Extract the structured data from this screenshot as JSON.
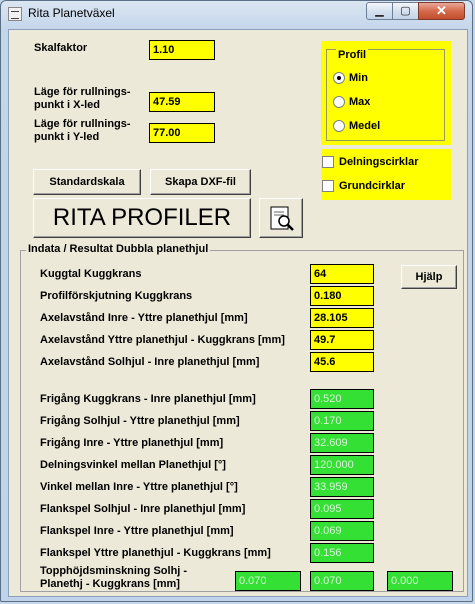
{
  "window": {
    "title": "Rita Planetväxel",
    "close_label": "✕",
    "min_label": "▁",
    "max_label": "▢"
  },
  "inputs": {
    "skalfaktor_label": "Skalfaktor",
    "skalfaktor_value": "1.10",
    "x_label_line1": "Läge för rullnings-",
    "x_label_line2": "punkt i X-led",
    "x_value": "47.59",
    "y_label_line1": "Läge för rullnings-",
    "y_label_line2": "punkt i Y-led",
    "y_value": "77.00"
  },
  "profil": {
    "title": "Profil",
    "options": [
      {
        "label": "Min",
        "selected": true
      },
      {
        "label": "Max",
        "selected": false
      },
      {
        "label": "Medel",
        "selected": false
      }
    ]
  },
  "checks": [
    {
      "label": "Delningscirklar",
      "checked": false
    },
    {
      "label": "Grundcirklar",
      "checked": false
    }
  ],
  "buttons": {
    "standardskala": "Standardskala",
    "dxf": "Skapa DXF-fil",
    "rita": "RITA PROFILER",
    "help": "Hjälp"
  },
  "indata": {
    "title": "Indata / Resultat  Dubbla planethjul",
    "rows": [
      {
        "label": "Kuggtal Kuggkrans",
        "value": "64"
      },
      {
        "label": "Profilförskjutning Kuggkrans",
        "value": "0.180"
      },
      {
        "label": "Axelavstånd Inre - Yttre planethjul [mm]",
        "value": "28.105"
      },
      {
        "label": "Axelavstånd Yttre planethjul - Kuggkrans [mm]",
        "value": "49.7"
      },
      {
        "label": "Axelavstånd Solhjul - Inre planethjul [mm]",
        "value": "45.6"
      }
    ],
    "results": [
      {
        "label": "Frigång Kuggkrans - Inre planethjul [mm]",
        "value": "0.520"
      },
      {
        "label": "Frigång Solhjul - Yttre planethjul [mm]",
        "value": "0.170"
      },
      {
        "label": "Frigång Inre - Yttre planethjul [mm]",
        "value": "32.609"
      },
      {
        "label": "Delningsvinkel mellan Planethjul [°]",
        "value": "120.000"
      },
      {
        "label": "Vinkel mellan Inre - Yttre planethjul [°]",
        "value": "33.959"
      },
      {
        "label": "Flankspel Solhjul - Inre planethjul [mm]",
        "value": "0.095"
      },
      {
        "label": "Flankspel Inre - Yttre planethjul [mm]",
        "value": "0.069"
      },
      {
        "label": "Flankspel Yttre planethjul - Kuggkrans [mm]",
        "value": "0.156"
      }
    ],
    "last": {
      "label_line1": "Topphöjdsminskning Solhj -",
      "label_line2": "Planethj - Kuggkrans [mm]",
      "values": [
        "0.070",
        "0.070",
        "0.000"
      ]
    }
  },
  "colors": {
    "input_bg": "#ffff00",
    "result_bg": "#33e033",
    "window_bg": "#ece9d8"
  }
}
